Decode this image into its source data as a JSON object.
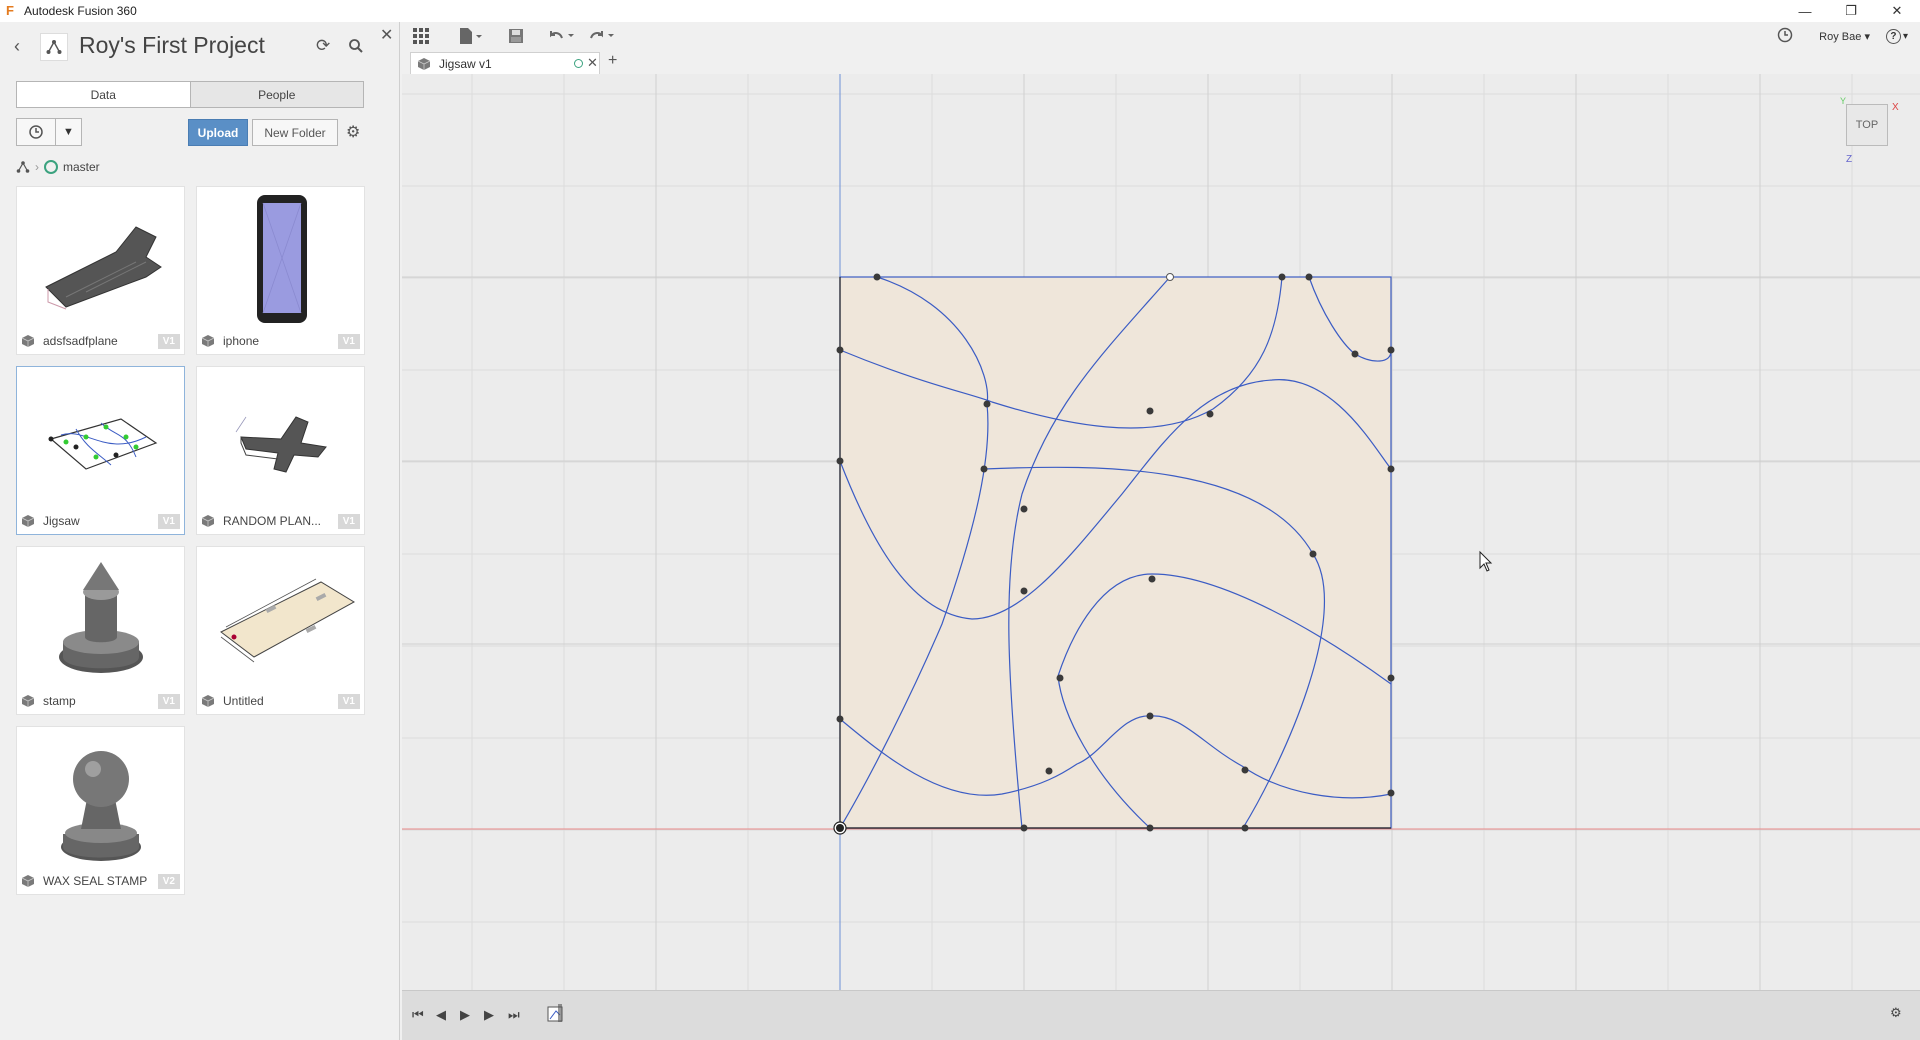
{
  "window": {
    "title": "Autodesk Fusion 360",
    "controls": [
      "—",
      "❐",
      "✕"
    ]
  },
  "panel": {
    "project_title": "Roy's First Project",
    "tabs": [
      {
        "label": "Data",
        "active": true
      },
      {
        "label": "People",
        "active": false
      }
    ],
    "upload_label": "Upload",
    "new_folder_label": "New Folder",
    "breadcrumb": {
      "branch": "master"
    },
    "files": [
      {
        "name": "adsfsadfplane",
        "version": "V1",
        "thumb": "plane3d"
      },
      {
        "name": "iphone",
        "version": "V1",
        "thumb": "phone"
      },
      {
        "name": "Jigsaw",
        "version": "V1",
        "thumb": "jigsaw",
        "selected": true
      },
      {
        "name": "RANDOM PLAN...",
        "version": "V1",
        "thumb": "jet"
      },
      {
        "name": "stamp",
        "version": "V1",
        "thumb": "stamp"
      },
      {
        "name": "Untitled",
        "version": "V1",
        "thumb": "board"
      },
      {
        "name": "WAX SEAL STAMP",
        "version": "V2",
        "thumb": "waxseal"
      }
    ]
  },
  "document": {
    "tab_name": "Jigsaw v1",
    "user_name": "Roy Bae",
    "user_caret": "▾",
    "help_label": "?",
    "viewcube": {
      "face": "TOP",
      "axes": {
        "x": "X",
        "y": "Y",
        "z": "Z"
      }
    }
  },
  "colors": {
    "accent_blue": "#5a8fc6",
    "sketch_line": "#3b5cc4",
    "sketch_fill": "#efe6da",
    "axis_red": "#e88888",
    "axis_blue": "#6d8fd6",
    "branch_green": "#3ba27f"
  },
  "icons": [
    "back-icon",
    "hub-icon",
    "refresh-icon",
    "search-icon",
    "close-icon",
    "gear-icon",
    "grid-menu-icon",
    "file-icon",
    "save-icon",
    "undo-icon",
    "redo-icon",
    "clock-icon",
    "help-icon",
    "cube-icon"
  ]
}
